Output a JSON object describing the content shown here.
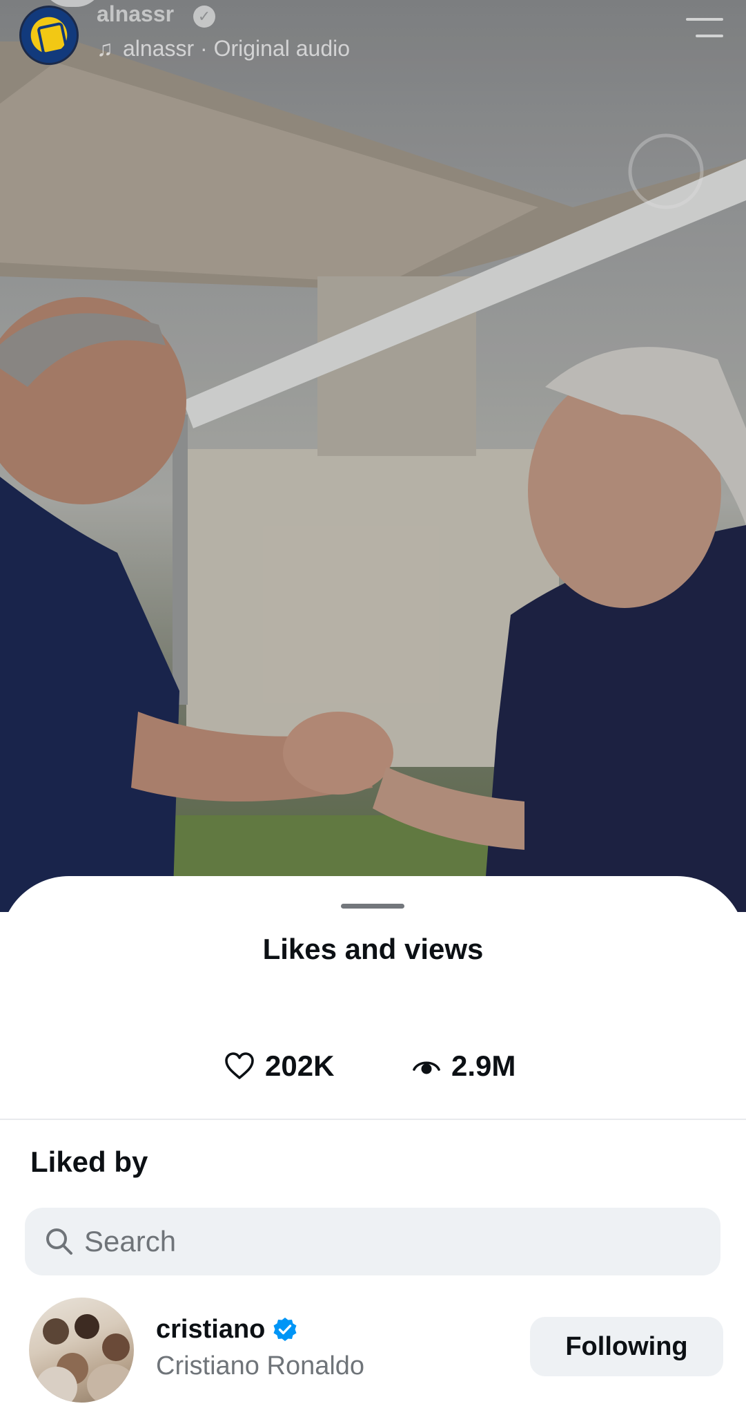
{
  "reel": {
    "username": "alnassr",
    "audio_label": "alnassr · Original audio"
  },
  "sheet": {
    "title": "Likes and views",
    "likes_count": "202K",
    "views_count": "2.9M",
    "liked_by_label": "Liked by",
    "search_placeholder": "Search"
  },
  "likers": [
    {
      "username": "cristiano",
      "full_name": "Cristiano Ronaldo",
      "verified": true,
      "button_label": "Following"
    }
  ],
  "colors": {
    "verified_blue": "#0095f6",
    "muted_text": "#6f7479",
    "search_bg": "#eef1f4",
    "club_gold": "#f2c814",
    "club_blue": "#123a7c"
  }
}
